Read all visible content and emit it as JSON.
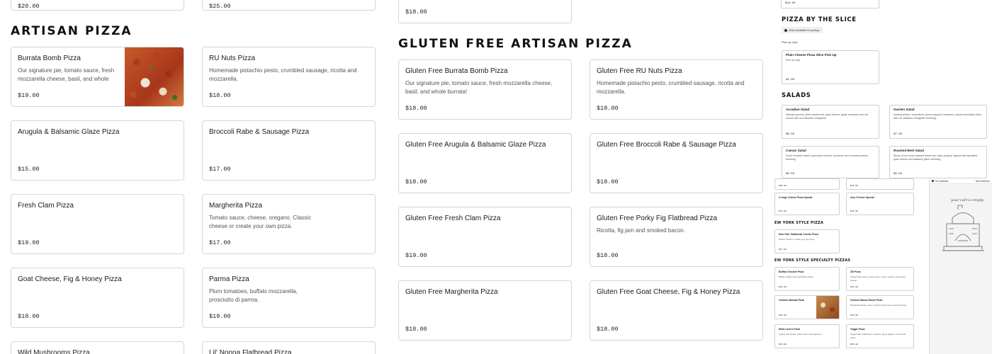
{
  "top_cut_prices": [
    "$20.00",
    "$25.00",
    "$18.00"
  ],
  "artisan": {
    "title": "Artisan Pizza",
    "items": [
      {
        "name": "Burrata Bomb Pizza",
        "desc": "Our signature pie, tomato sauce, fresh mozzarella cheese, basil, and whole",
        "price": "$19.00"
      },
      {
        "name": "RU Nuts Pizza",
        "desc": "Homemade pistachio pesto, crumbled sausage, ricotta and mozzarella.",
        "price": "$18.00"
      },
      {
        "name": "Arugula & Balsamic Glaze Pizza",
        "desc": "",
        "price": "$15.00"
      },
      {
        "name": "Broccoli Rabe & Sausage Pizza",
        "desc": "",
        "price": "$17.00"
      },
      {
        "name": "Fresh Clam Pizza",
        "desc": "",
        "price": "$19.00"
      },
      {
        "name": "Margherita Pizza",
        "desc": "Tomato sauce, cheese, oregano. Classic cheese or create your own pizza.",
        "price": "$17.00"
      },
      {
        "name": "Goat Cheese, Fig & Honey Pizza",
        "desc": "",
        "price": "$18.00"
      },
      {
        "name": "Parma Pizza",
        "desc": "Plum tomatoes, buffalo mozzarella, prosciutto di parma.",
        "price": "$19.00"
      },
      {
        "name": "Wild Mushrooms Pizza",
        "desc": "",
        "price": ""
      },
      {
        "name": "Lil' Nonna Flatbread Pizza",
        "desc": "",
        "price": ""
      }
    ]
  },
  "gluten_free": {
    "title": "Gluten Free Artisan Pizza",
    "items": [
      {
        "name": "Gluten Free Burrata Bomb Pizza",
        "desc": "Our signature pie, tomato sauce, fresh mozzarella cheese, basil, and whole burrata!",
        "price": "$18.00"
      },
      {
        "name": "Gluten Free RU Nuts Pizza",
        "desc": "Homemade pistachio pesto, crumbled sausage, ricotta and mozzarella.",
        "price": "$18.00"
      },
      {
        "name": "Gluten Free Arugula & Balsamic Glaze Pizza",
        "desc": "",
        "price": "$18.00"
      },
      {
        "name": "Gluten Free Broccoli Rabe & Sausage Pizza",
        "desc": "",
        "price": "$18.00"
      },
      {
        "name": "Gluten Free Fresh Clam Pizza",
        "desc": "",
        "price": "$19.00"
      },
      {
        "name": "Gluten Free Porky Fig Flatbread Pizza",
        "desc": "Ricotta, fig jam and smoked bacon.",
        "price": "$18.00"
      },
      {
        "name": "Gluten Free Margherita Pizza",
        "desc": "",
        "price": "$18.00"
      },
      {
        "name": "Gluten Free Goat Cheese, Fig & Honey Pizza",
        "desc": "",
        "price": "$18.00"
      }
    ]
  },
  "mini": {
    "top_price": "$18.00",
    "slice_title": "Pizza by the Slice",
    "pickup_badge": "Only available for pickup",
    "pickup_note": "Pick up only!",
    "slice_item": {
      "name": "Plain Cheese Pizza Slice Pick Up",
      "desc": "Pick up only!",
      "price": "$4.00"
    },
    "salads_title": "Salads",
    "salads": [
      {
        "name": "Arcadian Salad",
        "desc": "Mesclun greens, dried cranberries, goat cheese, grape tomatoes and red onions with our balsamic vinaigrette.",
        "price": "$9.50"
      },
      {
        "name": "Garden Salad",
        "desc": "Iceberg lettuce, cucumbers, green peppers, tomatoes, onions and black olives with our balsamic vinaigrette dressing.",
        "price": "$7.50"
      },
      {
        "name": "Caesar Salad",
        "desc": "Fresh romaine hearts, parmesan cheese, croutons, and a creamy caesar dressing.",
        "price": "$9.50"
      },
      {
        "name": "Roasted Beet Salad",
        "desc": "Slices of our home roasted beets over baby arugula, topped with sprinkled goat cheese and balsamic glaze dressing.",
        "price": "$9.50"
      }
    ],
    "specials": [
      {
        "name": "",
        "price": "$45.00"
      },
      {
        "name": "",
        "price": "$45.00"
      },
      {
        "name": "4 Large Cheese Pizza Special",
        "price": "$75.00"
      },
      {
        "name": "Any 2 Dinner Special",
        "price": "$45.00"
      }
    ],
    "ny_title": "EW YORK STYLE PIZZA",
    "ny_item": {
      "name": "New York Traditional Cheese Pizza",
      "desc": "Classic cheese or create your own pizza.",
      "price": "$17.00"
    },
    "ny_special_title": "EW YORK STYLE SPECIALTY PIZZAS",
    "ny_specials": [
      {
        "name": "Buffalo Chicken Pizza",
        "desc": "Buffalo chicken and mozzarella cheese.",
        "price": "$25.00"
      },
      {
        "name": "Ziti Pizza",
        "desc": "Topped with ricotta, tomato sauce, onions, peppers, and ricotta cheese.",
        "price": "$21.00"
      },
      {
        "name": "Chicken Marsala Pizza",
        "desc": "",
        "price": "$25.00"
      },
      {
        "name": "Chicken Bacon Ranch Pizza",
        "desc": "Mozzarella cheese, bacon, chicken, and creamy ranch dressing.",
        "price": "$25.00"
      },
      {
        "name": "Meat Lover's Pizza",
        "desc": "Topped with cheese, bacon, ham, and pepperoni.",
        "price": "$25.00"
      },
      {
        "name": "Veggie Pizza",
        "desc": "Topped with mushrooms, tomatoes, green peppers, onions and olives.",
        "price": "$25.00"
      }
    ]
  },
  "cart": {
    "address_label": "No address",
    "edit_label": "Add address",
    "empty_text": "your cart is empty"
  }
}
